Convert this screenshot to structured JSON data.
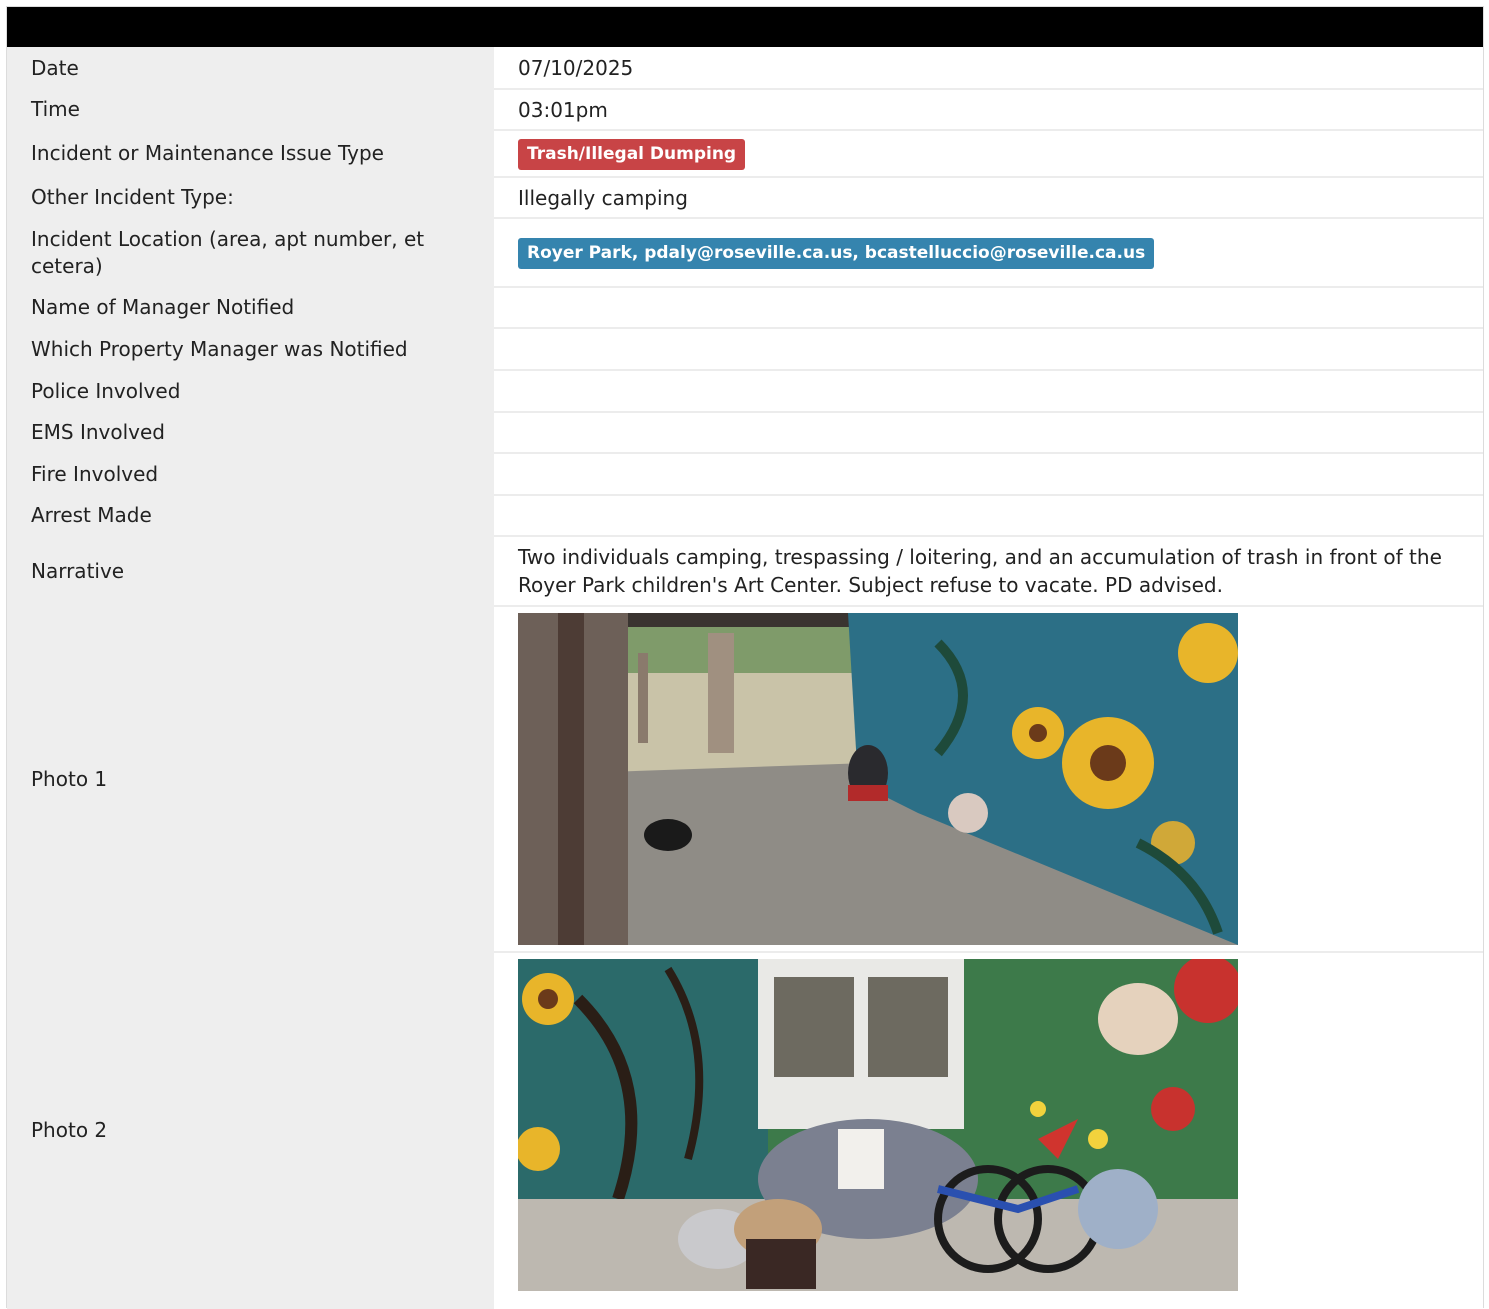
{
  "rows": {
    "date": {
      "label": "Date",
      "value": "07/10/2025"
    },
    "time": {
      "label": "Time",
      "value": "03:01pm"
    },
    "issue_type": {
      "label": "Incident or Maintenance Issue Type",
      "value": "Trash/Illegal Dumping",
      "color": "#c84446"
    },
    "other_type": {
      "label": "Other Incident Type:",
      "value": "Illegally camping"
    },
    "location": {
      "label": "Incident Location (area, apt number, et cetera)",
      "value": "Royer Park, pdaly@roseville.ca.us, bcastelluccio@roseville.ca.us",
      "color": "#3584ae"
    },
    "manager_name": {
      "label": "Name of Manager Notified",
      "value": ""
    },
    "property_manager": {
      "label": "Which Property Manager was Notified",
      "value": ""
    },
    "police": {
      "label": "Police Involved",
      "value": ""
    },
    "ems": {
      "label": "EMS Involved",
      "value": ""
    },
    "fire": {
      "label": "Fire Involved",
      "value": ""
    },
    "arrest": {
      "label": "Arrest Made",
      "value": ""
    },
    "narrative": {
      "label": "Narrative",
      "value": "Two individuals camping, trespassing / loitering, and an accumulation of trash in front of the Royer Park children's Art Center. Subject refuse to vacate. PD advised."
    },
    "photo1": {
      "label": "Photo 1"
    },
    "photo2": {
      "label": "Photo 2"
    }
  }
}
